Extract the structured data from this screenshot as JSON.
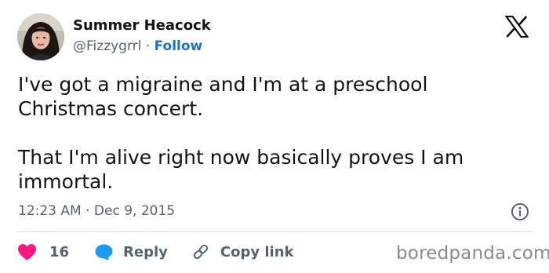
{
  "author": {
    "display_name": "Summer Heacock",
    "handle": "@Fizzygrrl",
    "separator": "·",
    "follow_label": "Follow"
  },
  "tweet": {
    "paragraphs": [
      "I've got a migraine and I'm at a preschool\nChristmas concert.",
      "That I'm alive right now basically proves I am\nimmortal."
    ],
    "timestamp": "12:23 AM · Dec 9, 2015"
  },
  "actions": {
    "like_count": "16",
    "reply_label": "Reply",
    "copy_link_label": "Copy link"
  },
  "watermark": "boredpanda.com",
  "colors": {
    "text": "#0f1419",
    "secondary": "#536471",
    "follow": "#1d70c6",
    "like": "#f91880",
    "reply": "#1d9bf0",
    "divider": "#cfd9de"
  },
  "icons": [
    "x-logo-icon",
    "info-icon",
    "heart-icon",
    "reply-bubble-icon",
    "link-icon"
  ]
}
